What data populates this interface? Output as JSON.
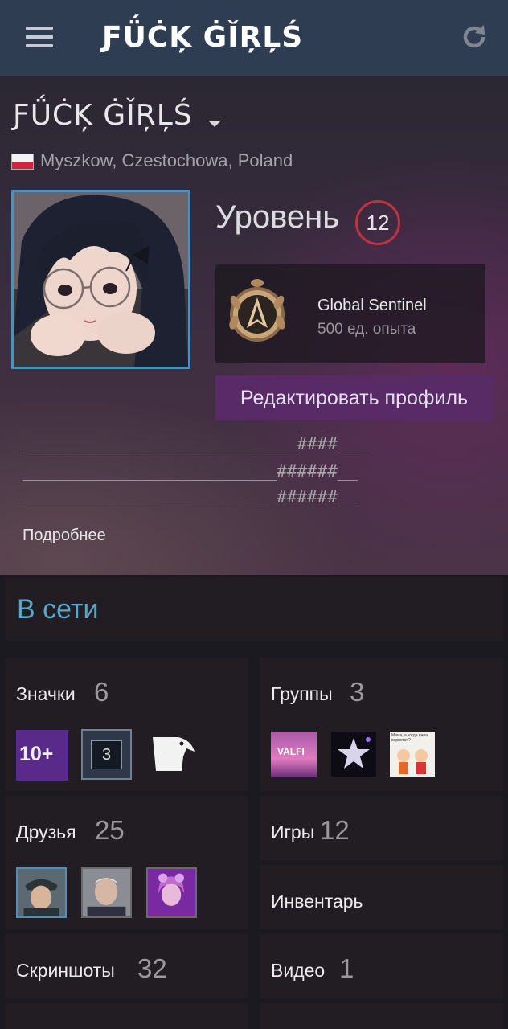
{
  "header": {
    "title": "ƑǗĊĶ ĠǏŖĻŚ",
    "menu_icon": "hamburger-menu-icon",
    "refresh_icon": "refresh-icon"
  },
  "profile": {
    "name": "ƑǗĊĶ ĠǏŖĻŚ",
    "location": "Myszkow, Czestochowa, Poland",
    "country_flag": "poland-flag-icon",
    "level_label": "Уровень",
    "level": "12",
    "badge_title": "Global Sentinel",
    "badge_xp": "500 ед. опыта",
    "edit_button": "Редактировать профиль",
    "summary_lines": [
      "___________________________####___",
      "_________________________######__",
      "_________________________######__"
    ],
    "more_link": "Подробнее"
  },
  "status": {
    "online_label": "В сети"
  },
  "sections": {
    "badges": {
      "label": "Значки",
      "count": "6",
      "thumb_text": [
        "10+",
        "3"
      ]
    },
    "groups": {
      "label": "Группы",
      "count": "3",
      "thumb_text": [
        "VALFI",
        "Мама, а когда папа вернется?"
      ]
    },
    "friends": {
      "label": "Друзья",
      "count": "25"
    },
    "games": {
      "label": "Игры",
      "count": "12"
    },
    "inventory": {
      "label": "Инвентарь"
    },
    "screenshots": {
      "label": "Скриншоты",
      "count": "32"
    },
    "videos": {
      "label": "Видео",
      "count": "1"
    }
  },
  "colors": {
    "topbar": "#2f3d52",
    "online_accent": "#5aa7c9",
    "level_ring": "#c0333f",
    "edit_button": "#582a66",
    "avatar_border": "#4f8fbd"
  }
}
